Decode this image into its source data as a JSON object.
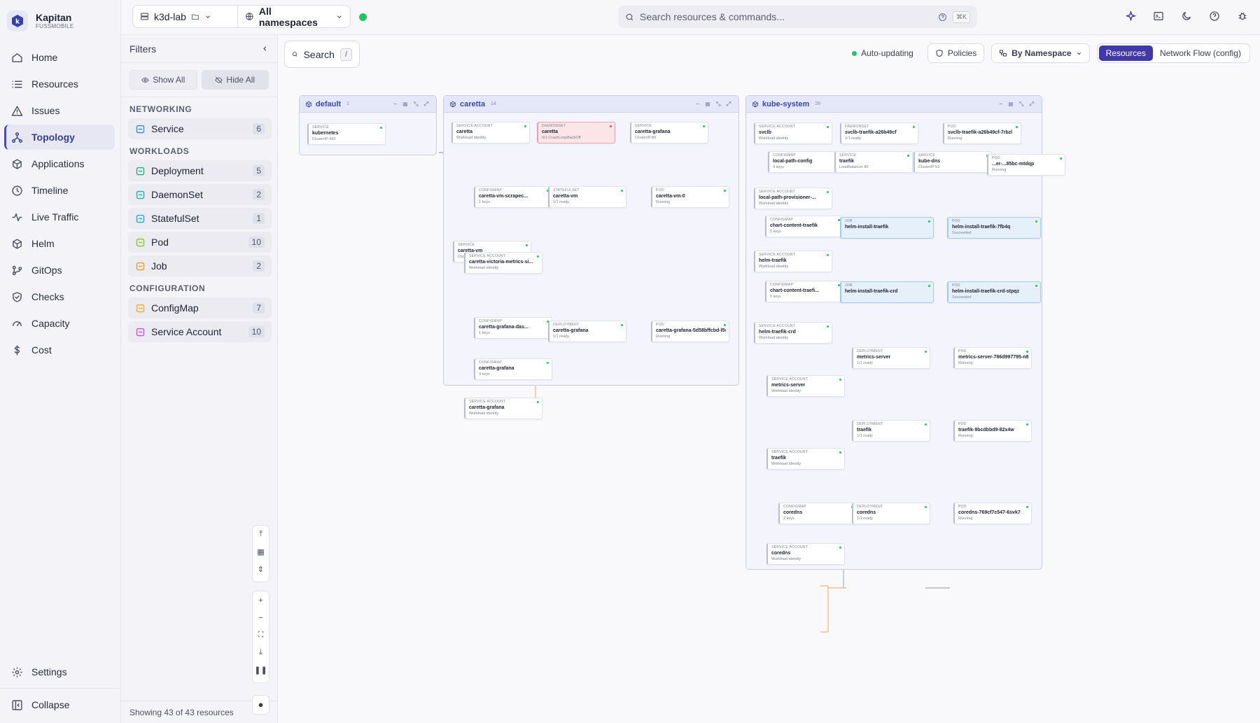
{
  "brand": {
    "name": "Kapitan",
    "sub": "FUSSMOBILE"
  },
  "nav": [
    {
      "label": "Home",
      "icon": "home-icon"
    },
    {
      "label": "Resources",
      "icon": "list-icon"
    },
    {
      "label": "Issues",
      "icon": "warning-icon"
    },
    {
      "label": "Topology",
      "icon": "topology-icon",
      "active": true
    },
    {
      "label": "Applications",
      "icon": "apps-icon"
    },
    {
      "label": "Timeline",
      "icon": "clock-icon"
    },
    {
      "label": "Live Traffic",
      "icon": "pulse-icon"
    },
    {
      "label": "Helm",
      "icon": "package-icon"
    },
    {
      "label": "GitOps",
      "icon": "git-icon"
    },
    {
      "label": "Checks",
      "icon": "shield-icon"
    },
    {
      "label": "Capacity",
      "icon": "gauge-icon"
    },
    {
      "label": "Cost",
      "icon": "dollar-icon"
    }
  ],
  "nav_bottom": {
    "settings": "Settings",
    "collapse": "Collapse"
  },
  "topbar": {
    "cluster": "k3d-lab",
    "namespace": "All namespaces",
    "search_placeholder": "Search resources & commands...",
    "shortcut": "⌘K"
  },
  "filters": {
    "title": "Filters",
    "show_all": "Show All",
    "hide_all": "Hide All",
    "sections": [
      {
        "title": "NETWORKING",
        "items": [
          {
            "label": "Service",
            "count": "6",
            "color": "#3b82f6"
          }
        ]
      },
      {
        "title": "WORKLOADS",
        "items": [
          {
            "label": "Deployment",
            "count": "5",
            "color": "#10b981"
          },
          {
            "label": "DaemonSet",
            "count": "2",
            "color": "#14b8a6"
          },
          {
            "label": "StatefulSet",
            "count": "1",
            "color": "#06b6d4"
          },
          {
            "label": "Pod",
            "count": "10",
            "color": "#84cc16"
          },
          {
            "label": "Job",
            "count": "2",
            "color": "#f59e0b"
          }
        ]
      },
      {
        "title": "CONFIGURATION",
        "items": [
          {
            "label": "ConfigMap",
            "count": "7",
            "color": "#eab308"
          },
          {
            "label": "Service Account",
            "count": "10",
            "color": "#d946ef"
          }
        ]
      }
    ],
    "showing": "Showing 43 of 43 resources"
  },
  "canvas": {
    "search": "Search",
    "search_key": "/",
    "auto": "Auto-updating",
    "policies": "Policies",
    "group": "By Namespace",
    "view_resources": "Resources",
    "view_network": "Network Flow (config)"
  },
  "namespaces": [
    {
      "name": "default",
      "count": "1"
    },
    {
      "name": "caretta",
      "count": "14"
    },
    {
      "name": "kube-system",
      "count": "28"
    }
  ],
  "nodes": [
    {
      "ns": 0,
      "kind": "SERVICE",
      "name": "kubernetes",
      "sub": "ClusterIP 443"
    },
    {
      "ns": 1,
      "kind": "SERVICE ACCOUNT",
      "name": "caretta",
      "sub": "Workload identity"
    },
    {
      "ns": 1,
      "kind": "DAEMONSET",
      "name": "caretta",
      "sub": "0/1 CrashLoopBackOff",
      "red": true
    },
    {
      "ns": 1,
      "kind": "SERVICE",
      "name": "caretta-grafana",
      "sub": "ClusterIP 80"
    },
    {
      "ns": 1,
      "kind": "CONFIGMAP",
      "name": "caretta-vm-scrapec...",
      "sub": "1 keys"
    },
    {
      "ns": 1,
      "kind": "STATEFULSET",
      "name": "caretta-vm",
      "sub": "1/1 ready"
    },
    {
      "ns": 1,
      "kind": "POD",
      "name": "caretta-vm-0",
      "sub": "Running"
    },
    {
      "ns": 1,
      "kind": "SERVICE",
      "name": "caretta-vm",
      "sub": "ClusterIP"
    },
    {
      "ns": 1,
      "kind": "SERVICE ACCOUNT",
      "name": "caretta-victoria-metrics-si...",
      "sub": "Workload identity"
    },
    {
      "ns": 1,
      "kind": "CONFIGMAP",
      "name": "caretta-grafana-das...",
      "sub": "1 keys"
    },
    {
      "ns": 1,
      "kind": "DEPLOYMENT",
      "name": "caretta-grafana",
      "sub": "1/1 ready"
    },
    {
      "ns": 1,
      "kind": "POD",
      "name": "caretta-grafana-5d58bffcbd-l5v8f",
      "sub": "Running"
    },
    {
      "ns": 1,
      "kind": "CONFIGMAP",
      "name": "caretta-grafana",
      "sub": "3 keys"
    },
    {
      "ns": 1,
      "kind": "SERVICE ACCOUNT",
      "name": "caretta-grafana",
      "sub": "Workload identity"
    },
    {
      "ns": 2,
      "kind": "SERVICE ACCOUNT",
      "name": "svclb",
      "sub": "Workload identity"
    },
    {
      "ns": 2,
      "kind": "DAEMONSET",
      "name": "svclb-traefik-a26b49cf",
      "sub": "1/1 ready"
    },
    {
      "ns": 2,
      "kind": "POD",
      "name": "svclb-traefik-a26b49cf-7rbzl",
      "sub": "Running"
    },
    {
      "ns": 2,
      "kind": "CONFIGMAP",
      "name": "local-path-config",
      "sub": "4 keys"
    },
    {
      "ns": 2,
      "kind": "SERVICE",
      "name": "traefik",
      "sub": "LoadBalancer 80"
    },
    {
      "ns": 2,
      "kind": "SERVICE",
      "name": "kube-dns",
      "sub": "ClusterIP 53"
    },
    {
      "ns": 2,
      "kind": "POD",
      "name": "...er-...85bc-mtdqp",
      "sub": "Running"
    },
    {
      "ns": 2,
      "kind": "SERVICE ACCOUNT",
      "name": "local-path-provisioner-...",
      "sub": "Workload identity"
    },
    {
      "ns": 2,
      "kind": "CONFIGMAP",
      "name": "chart-content-traefik",
      "sub": "0 keys"
    },
    {
      "ns": 2,
      "kind": "JOB",
      "name": "helm-install-traefik",
      "sub": "",
      "blue": true
    },
    {
      "ns": 2,
      "kind": "POD",
      "name": "helm-install-traefik-7fb4q",
      "sub": "Succeeded",
      "blue": true
    },
    {
      "ns": 2,
      "kind": "SERVICE ACCOUNT",
      "name": "helm-traefik",
      "sub": "Workload identity"
    },
    {
      "ns": 2,
      "kind": "CONFIGMAP",
      "name": "chart-content-traefi...",
      "sub": "0 keys"
    },
    {
      "ns": 2,
      "kind": "JOB",
      "name": "helm-install-traefik-crd",
      "sub": "",
      "blue": true
    },
    {
      "ns": 2,
      "kind": "POD",
      "name": "helm-install-traefik-crd-stpqz",
      "sub": "Succeeded",
      "blue": true
    },
    {
      "ns": 2,
      "kind": "SERVICE ACCOUNT",
      "name": "helm-traefik-crd",
      "sub": "Workload identity"
    },
    {
      "ns": 2,
      "kind": "DEPLOYMENT",
      "name": "metrics-server",
      "sub": "1/1 ready"
    },
    {
      "ns": 2,
      "kind": "POD",
      "name": "metrics-server-786d997795-n8xh4",
      "sub": "Running"
    },
    {
      "ns": 2,
      "kind": "SERVICE ACCOUNT",
      "name": "metrics-server",
      "sub": "Workload identity"
    },
    {
      "ns": 2,
      "kind": "DEPLOYMENT",
      "name": "traefik",
      "sub": "1/1 ready"
    },
    {
      "ns": 2,
      "kind": "POD",
      "name": "traefik-9bcdbbd9-82x4w",
      "sub": "Running"
    },
    {
      "ns": 2,
      "kind": "SERVICE ACCOUNT",
      "name": "traefik",
      "sub": "Workload identity"
    },
    {
      "ns": 2,
      "kind": "CONFIGMAP",
      "name": "coredns",
      "sub": "2 keys"
    },
    {
      "ns": 2,
      "kind": "DEPLOYMENT",
      "name": "coredns",
      "sub": "1/1 ready"
    },
    {
      "ns": 2,
      "kind": "POD",
      "name": "coredns-769cf7c547-6svk7",
      "sub": "Running"
    },
    {
      "ns": 2,
      "kind": "SERVICE ACCOUNT",
      "name": "coredns",
      "sub": "Workload identity"
    }
  ],
  "colors": {
    "accent": "#4338a8",
    "healthy": "#22c55e",
    "error": "#ef4444",
    "edge_orange": "#f4a259",
    "edge_blue": "#7aa9d6"
  }
}
